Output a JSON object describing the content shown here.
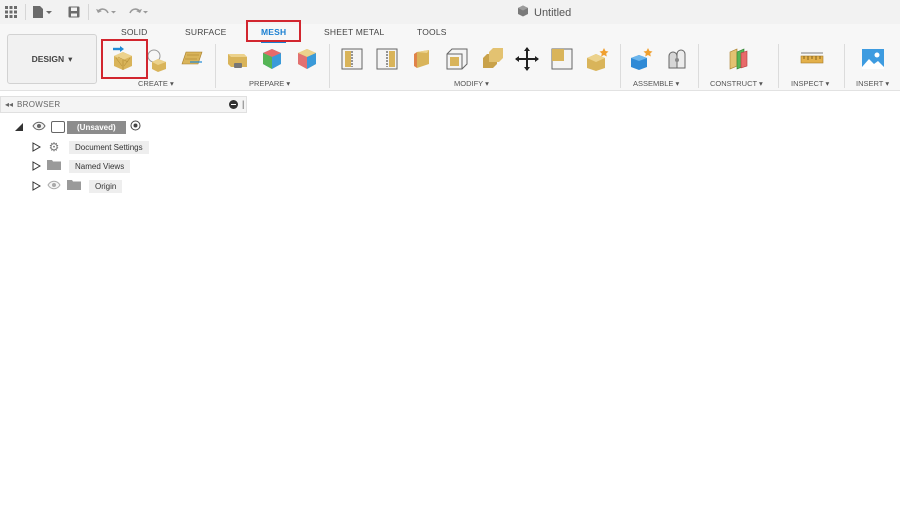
{
  "window": {
    "title": "Untitled"
  },
  "tabs": [
    {
      "label": "SOLID",
      "active": false
    },
    {
      "label": "SURFACE",
      "active": false
    },
    {
      "label": "MESH",
      "active": true
    },
    {
      "label": "SHEET METAL",
      "active": false
    },
    {
      "label": "TOOLS",
      "active": false
    }
  ],
  "workspace_button": {
    "label": "DESIGN",
    "arrow": "▾"
  },
  "groups": {
    "create": "CREATE ▾",
    "prepare": "PREPARE ▾",
    "modify": "MODIFY ▾",
    "assemble": "ASSEMBLE ▾",
    "construct": "CONSTRUCT ▾",
    "inspect": "INSPECT ▾",
    "insert": "INSERT ▾"
  },
  "browser": {
    "title": "BROWSER",
    "root": {
      "label": "(Unsaved)"
    },
    "items": [
      {
        "label": "Document Settings",
        "icon": "gear-icon"
      },
      {
        "label": "Named Views",
        "icon": "folder-icon"
      },
      {
        "label": "Origin",
        "icon": "folder-icon"
      }
    ]
  },
  "colors": {
    "accent": "#1a7fd1",
    "highlight": "#d2262f",
    "mesh_gold": "#d9b45a"
  }
}
